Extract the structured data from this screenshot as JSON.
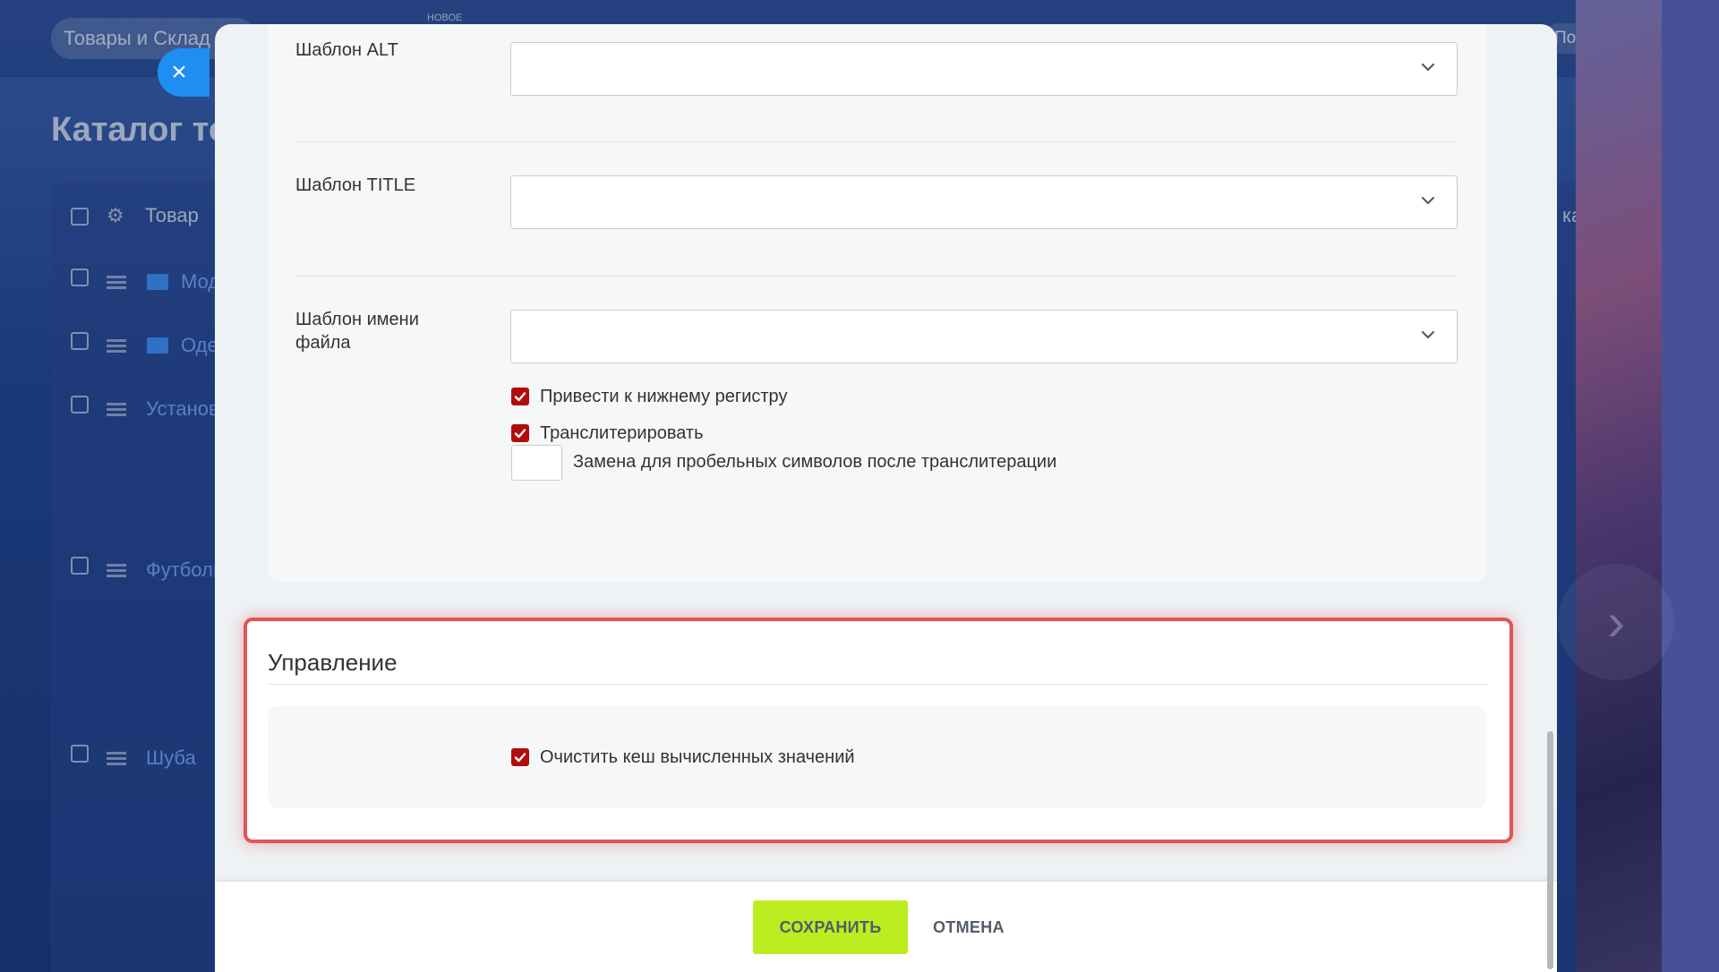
{
  "background": {
    "search_text": "Товары и Склад",
    "new_label": "НОВОЕ",
    "help_label": "Помощь",
    "page_title": "Каталог то",
    "table_header_product": "Товар",
    "table_header_right": "ка при с",
    "rows": [
      "Мод",
      "Оде",
      "Установ",
      "Футболк",
      "Шуба"
    ]
  },
  "modal": {
    "fields": {
      "alt_label": "Шаблон ALT",
      "title_label": "Шаблон TITLE",
      "filename_label": "Шаблон имени файла",
      "alt_value": "",
      "title_value": "",
      "filename_value": ""
    },
    "options": {
      "lowercase_label": "Привести к нижнему регистру",
      "lowercase_checked": true,
      "translit_label": "Транслитерировать",
      "translit_checked": true,
      "space_replace_label": "Замена для пробельных символов после транслитерации",
      "space_replace_value": ""
    },
    "management": {
      "title": "Управление",
      "clear_cache_label": "Очистить кеш вычисленных значений",
      "clear_cache_checked": true
    },
    "footer": {
      "save_label": "СОХРАНИТЬ",
      "cancel_label": "ОТМЕНА"
    }
  },
  "colors": {
    "checkbox": "#b10d0d",
    "save_button": "#bbed21",
    "highlight_border": "#e25458",
    "close_button": "#1f8ef2"
  }
}
